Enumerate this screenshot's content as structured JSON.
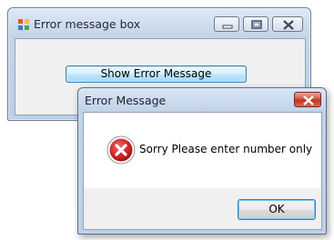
{
  "main_window": {
    "title": "Error message box",
    "show_button_label": "Show Error Message"
  },
  "dialog": {
    "title": "Error Message",
    "message": "Sorry Please enter number only",
    "ok_label": "OK",
    "icon": "error-icon"
  },
  "colors": {
    "error_red": "#c8232b",
    "close_red": "#c12f1b",
    "client_bg": "#f0f0f0"
  }
}
